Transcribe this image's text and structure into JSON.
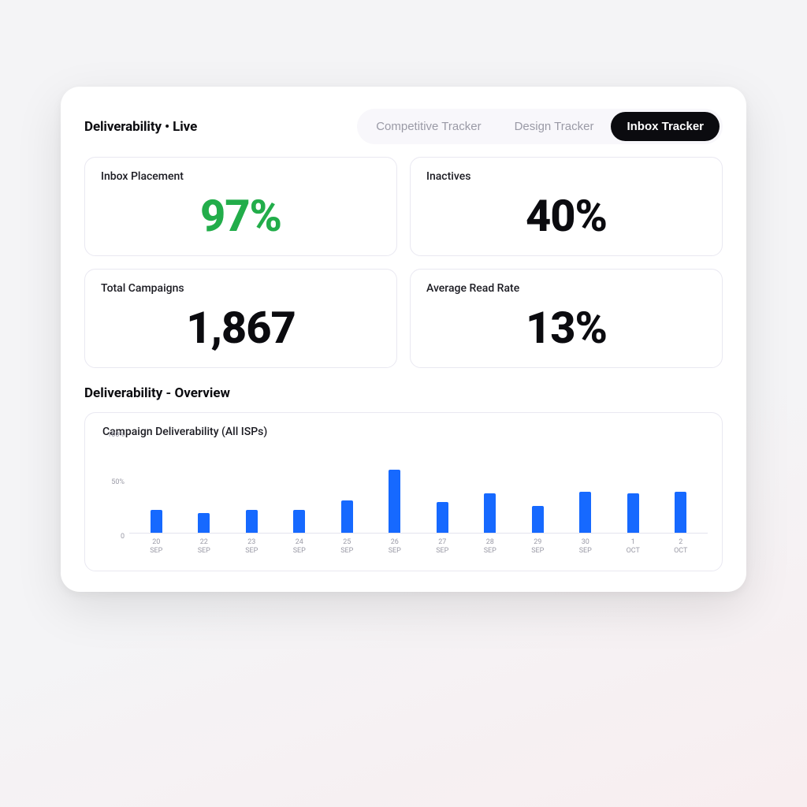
{
  "header": {
    "section_title": "Deliverability • Live",
    "tabs": [
      {
        "label": "Competitive Tracker",
        "active": false
      },
      {
        "label": "Design Tracker",
        "active": false
      },
      {
        "label": "Inbox Tracker",
        "active": true
      }
    ]
  },
  "stats": [
    {
      "label": "Inbox Placement",
      "value": "97%",
      "accent": "green"
    },
    {
      "label": "Inactives",
      "value": "40%",
      "accent": "black"
    },
    {
      "label": "Total Campaigns",
      "value": "1,867",
      "accent": "black"
    },
    {
      "label": "Average Read Rate",
      "value": "13%",
      "accent": "black"
    }
  ],
  "overview": {
    "title": "Deliverability - Overview",
    "chart_title": "Campaign Deliverability (All ISPs)"
  },
  "colors": {
    "bar": "#1669ff",
    "accent_green": "#22ad4a",
    "text": "#0b0b0f",
    "muted": "#9a9aa6"
  },
  "chart_data": {
    "type": "bar",
    "title": "Campaign Deliverability (All ISPs)",
    "xlabel": "",
    "ylabel": "",
    "ylim": [
      0,
      100
    ],
    "y_ticks": [
      "0",
      "50%",
      "100%"
    ],
    "categories": [
      {
        "day": "20",
        "month": "SEP"
      },
      {
        "day": "22",
        "month": "SEP"
      },
      {
        "day": "23",
        "month": "SEP"
      },
      {
        "day": "24",
        "month": "SEP"
      },
      {
        "day": "25",
        "month": "SEP"
      },
      {
        "day": "26",
        "month": "SEP"
      },
      {
        "day": "27",
        "month": "SEP"
      },
      {
        "day": "28",
        "month": "SEP"
      },
      {
        "day": "29",
        "month": "SEP"
      },
      {
        "day": "30",
        "month": "SEP"
      },
      {
        "day": "1",
        "month": "OCT"
      },
      {
        "day": "2",
        "month": "OCT"
      }
    ],
    "values": [
      26,
      22,
      26,
      26,
      36,
      70,
      34,
      44,
      30,
      46,
      44,
      46
    ]
  }
}
